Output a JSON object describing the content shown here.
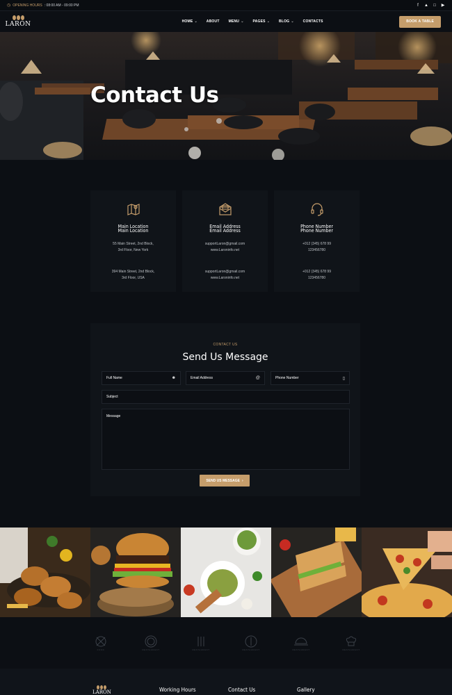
{
  "topbar": {
    "hours_label": "OPENING HOURS",
    "hours_value": ": 08:00 AM - 09:00 PM",
    "social": [
      "facebook-icon",
      "twitter-icon",
      "instagram-icon",
      "youtube-icon"
    ]
  },
  "nav": {
    "logo": "LARON",
    "items": [
      {
        "label": "HOME",
        "dropdown": true
      },
      {
        "label": "ABOUT",
        "dropdown": false
      },
      {
        "label": "MENU",
        "dropdown": true
      },
      {
        "label": "PAGES",
        "dropdown": true
      },
      {
        "label": "BLOG",
        "dropdown": true
      },
      {
        "label": "CONTACTS",
        "dropdown": false
      }
    ],
    "cta": "BOOK A TABLE"
  },
  "hero": {
    "title": "Contact Us"
  },
  "cards": [
    {
      "icon": "map-icon",
      "title": "Main Location",
      "lines1": [
        "55 Main Street, 2nd Block,",
        "3rd Floor, New York"
      ],
      "lines2": [
        "394 Main Street, 2nd Block,",
        "3rd Floor, USA"
      ]
    },
    {
      "icon": "envelope-icon",
      "title": "Email Address",
      "lines1": [
        "supportLaron@gmail.com",
        "www.Laroninfo.net"
      ],
      "lines2": [
        "supportLaron@gmail.com",
        "www.Laroninfo.net"
      ]
    },
    {
      "icon": "headset-icon",
      "title": "Phone Number",
      "lines1": [
        "+012 (345) 678 99",
        "123456780"
      ],
      "lines2": [
        "+012 (345) 678 99",
        "123456780"
      ]
    }
  ],
  "form": {
    "kicker": "CONTACT US",
    "title": "Send Us Message",
    "full_name": "Full Name",
    "email": "Email Address",
    "phone": "Phone Number",
    "subject": "Subject",
    "message": "Message",
    "submit": "SEND US MESSAGE"
  },
  "gallery": [
    "fried-chicken",
    "burger",
    "pasta-bowl",
    "sandwich",
    "pizza"
  ],
  "brands": [
    "FOOD",
    "RESTAURANT",
    "RESTAURANT",
    "RESTAURANT",
    "RESTAURANT",
    "RESTAURANT"
  ],
  "footer": {
    "logo": "LARON",
    "headings": [
      "Working Hours",
      "Contact Us",
      "Gallery"
    ]
  },
  "colors": {
    "accent": "#c59d6b",
    "bg": "#0c0f14",
    "card": "#101419"
  }
}
